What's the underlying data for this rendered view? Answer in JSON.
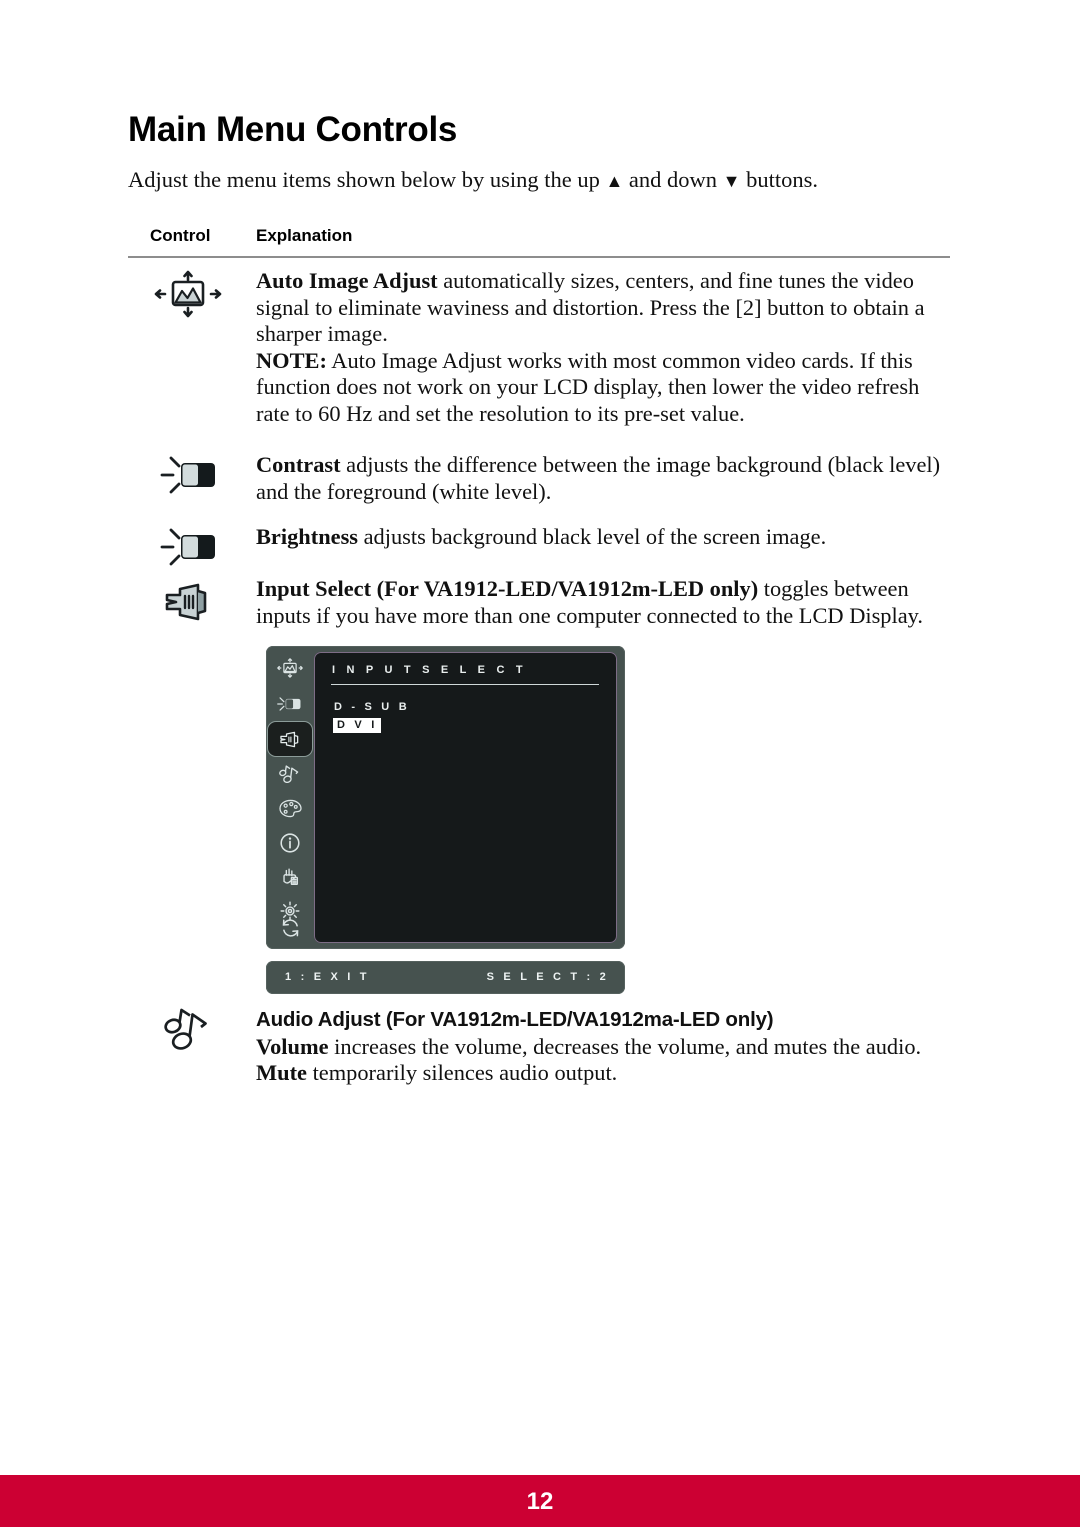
{
  "document": {
    "heading": "Main Menu Controls",
    "intro_before": "Adjust the menu items shown below by using the up ",
    "intro_up_glyph": "▲",
    "intro_middle": " and down ",
    "intro_down_glyph": "▼",
    "intro_after": " buttons.",
    "page_number": "12",
    "footer_color": "#cc0033"
  },
  "table": {
    "col_control": "Control",
    "col_explanation": "Explanation"
  },
  "rows": [
    {
      "id": "auto-image-adjust",
      "icon": "auto-image-adjust-icon",
      "term": "Auto Image Adjust",
      "body": " automatically sizes, centers, and fine tunes the video signal to eliminate waviness and distortion. Press the [2] button to obtain a sharper image.",
      "note_label": "NOTE:",
      "note_body": " Auto Image Adjust works with most common video cards. If this function does not work on your LCD display, then lower the video refresh rate to 60 Hz and set the resolution to its pre-set value."
    },
    {
      "id": "contrast",
      "icon": "contrast-icon",
      "term": "Contrast",
      "body": " adjusts the difference between the image background (black level) and the foreground (white level)."
    },
    {
      "id": "brightness",
      "icon": "brightness-icon",
      "term": "Brightness",
      "body": " adjusts background black level of the screen image."
    },
    {
      "id": "input-select",
      "icon": "input-select-icon",
      "term": "Input Select (For VA1912-LED/VA1912m-LED only)",
      "body": " toggles between inputs if you have more than one computer connected to the LCD Display."
    },
    {
      "id": "audio-adjust",
      "icon": "audio-adjust-icon",
      "heading": "Audio Adjust (For VA1912m-LED/VA1912ma-LED only)",
      "term1": "Volume",
      "body1": " increases the volume, decreases the volume, and mutes the audio.",
      "term2": "Mute",
      "body2": " temporarily silences audio output."
    }
  ],
  "osd": {
    "title": "I N P U T   S E L E C T",
    "options": [
      {
        "label": "D - S U B",
        "selected": false
      },
      {
        "label": "D V I",
        "selected": true
      }
    ],
    "footer_left": "1 : E X I T",
    "footer_right": "S E L E C T : 2",
    "sidebar_icons": [
      "auto-image-adjust-icon",
      "contrast-brightness-icon",
      "input-select-icon",
      "audio-adjust-icon",
      "color-adjust-icon",
      "information-icon",
      "manual-image-adjust-icon",
      "setup-menu-icon",
      "memory-recall-icon"
    ],
    "selected_sidebar_index": 2,
    "panel_color": "#46524f",
    "screen_color": "#15191a"
  }
}
